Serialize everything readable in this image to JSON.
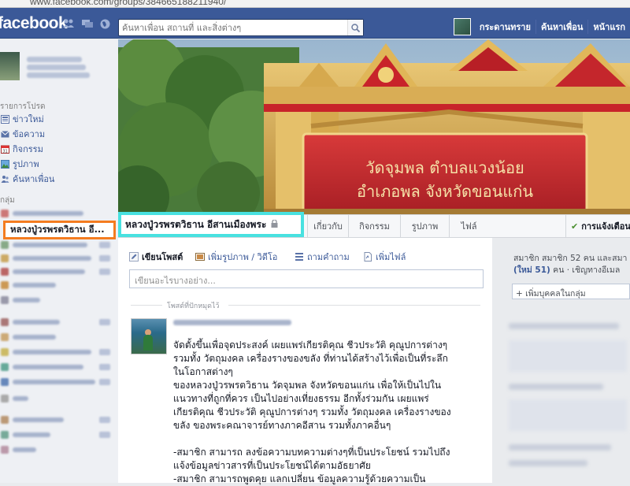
{
  "browser": {
    "url": "www.facebook.com/groups/384665188211940/"
  },
  "topbar": {
    "logo": "facebook",
    "search_placeholder": "ค้นหาเพื่อน สถานที่ และสิ่งต่างๆ",
    "nav": [
      "กระดานทราย",
      "ค้นหาเพื่อน",
      "หน้าแรก"
    ]
  },
  "sidebar": {
    "favorites_header": "รายการโปรด",
    "favorites": [
      "ข่าวใหม่",
      "ข้อความ",
      "กิจกรรม",
      "รูปภาพ",
      "ค้นหาเพื่อน"
    ],
    "groups_header": "กลุ่ม",
    "active_group": "หลวงปู่วรพรตวิธาน อี..."
  },
  "group": {
    "title": "หลวงปู่วรพรตวิธาน อีสานเมืองพระ",
    "tabs": [
      "เกี่ยวกับ",
      "กิจกรรม",
      "รูปภาพ",
      "ไฟล์"
    ],
    "notifications": "การแจ้งเตือน",
    "cover_sign_line1": "วัดจุมพล ตำบลแวงน้อย",
    "cover_sign_line2": "อำเภอพล จังหวัดขอนแก่น"
  },
  "composer": {
    "write_post": "เขียนโพสต์",
    "add_photo": "เพิ่มรูปภาพ / วิดีโอ",
    "ask_question": "ถามคำถาม",
    "add_file": "เพิ่มไฟล์",
    "placeholder": "เขียนอะไรบางอย่าง..."
  },
  "pinned_label": "โพสต์ที่ปักหมุดไว้",
  "post": {
    "lines": [
      "จัดตั้งขึ้นเพื่อจุดประสงค์ เผยแพร่เกียรติคุณ ชีวประวัติ คุณูปการต่างๆ",
      "รวมทั้ง วัตถุมงคล เครื่องรางของขลัง ที่ท่านได้สร้างไว้เพื่อเป็นที่ระลึก",
      "ในโอกาสต่างๆ",
      "ของหลวงปู่วรพรตวิธาน วัดจุมพล จังหวัดขอนแก่น เพื่อให้เป็นไปใน",
      "แนวทางที่ถูกที่ควร เป็นไปอย่างเที่ยงธรรม อีกทั้งร่วมกัน เผยแพร่",
      "เกียรติคุณ ชีวประวัติ คุณูปการต่างๆ รวมทั้ง วัตถุมงคล เครื่องรางของ",
      "ขลัง ของพระคณาจารย์ทางภาคอีสาน รวมทั้งภาคอื่นๆ",
      "",
      "-สมาชิก สามารถ ลงข้อความบทความต่างๆที่เป็นประโยชน์ รวมไปถึง",
      "แจ้งข้อมูลข่าวสารที่เป็นประโยชน์ได้ตามอัธยาศัย",
      "-สมาชิก สามารถพูดคุย แลกเปลี่ยน ข้อมูลความรู้ด้วยความเป็น"
    ]
  },
  "rightcol": {
    "members_line1": "สมาชิก สมาชิก 52 คน และสมา",
    "members_new": "(ใหม่ 51)",
    "members_line2_rest": " คน · เชิญทางอีเมล",
    "add_person": "+ เพิ่มบุคคลในกลุ่ม"
  },
  "colors": {
    "brand": "#3b5998",
    "highlight_cyan": "#48e1e0",
    "highlight_orange": "#f47c20"
  }
}
